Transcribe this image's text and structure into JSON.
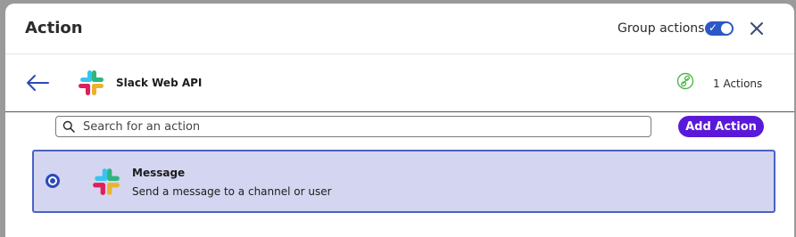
{
  "header": {
    "title": "Action",
    "group_actions_label": "Group actions",
    "group_actions_enabled": true,
    "toggle_check": "✓"
  },
  "app": {
    "name": "Slack Web API",
    "actions_count": "1 Actions",
    "logo_icon": "slack-logo-icon",
    "link_icon": "link-icon"
  },
  "search": {
    "placeholder": "Search for an action",
    "value": ""
  },
  "toolbar": {
    "add_action_label": "Add Action"
  },
  "actions": [
    {
      "title": "Message",
      "description": "Send a message to a channel or user",
      "selected": true,
      "icon": "slack-logo-icon"
    }
  ],
  "colors": {
    "accent": "#5a19d9",
    "toggle": "#2c57c6",
    "selected_bg": "#d4d6f1",
    "selected_border": "#4b62c4",
    "link_icon": "#4fb848"
  }
}
